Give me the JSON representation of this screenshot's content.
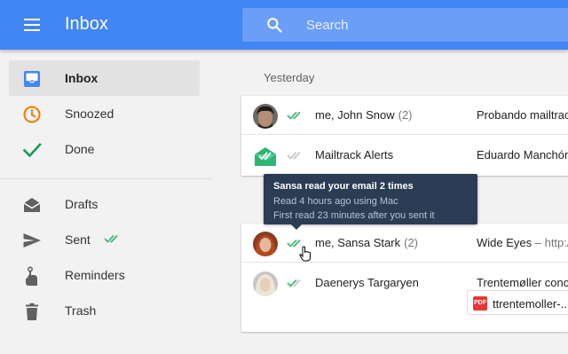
{
  "header": {
    "title": "Inbox",
    "search_placeholder": "Search"
  },
  "colors": {
    "header_blue": "#4285f4",
    "snoozed_orange": "#f57c00",
    "done_green": "#0f9d58",
    "mailtrack_tick_green": "#43b77a",
    "tooltip_navy": "#2b3c55"
  },
  "sidebar": {
    "items": [
      {
        "label": "Inbox",
        "icon": "inbox-icon",
        "active": true
      },
      {
        "label": "Snoozed",
        "icon": "clock-icon"
      },
      {
        "label": "Done",
        "icon": "checkmark-icon"
      },
      {
        "label": "Drafts",
        "icon": "drafts-icon"
      },
      {
        "label": "Sent",
        "icon": "send-icon",
        "badge_icon": "double-check-icon"
      },
      {
        "label": "Reminders",
        "icon": "reminder-icon"
      },
      {
        "label": "Trash",
        "icon": "trash-icon"
      }
    ]
  },
  "main": {
    "section_label": "Yesterday",
    "emails": [
      {
        "sender": "me, John Snow",
        "count": "(2)",
        "subject": "Probando mailtrack",
        "snippet": "",
        "ticks": "read",
        "avatar": "john-snow-avatar"
      },
      {
        "sender": "Mailtrack Alerts",
        "count": "",
        "subject": "Eduardo Manchón",
        "snippet": "",
        "ticks": "unread",
        "avatar": "mailtrack-logo"
      },
      {
        "sender": "me, Sansa Stark",
        "count": "(2)",
        "subject": "Wide Eyes",
        "snippet": " – http://",
        "ticks": "read",
        "avatar": "sansa-stark-avatar"
      },
      {
        "sender": "Daenerys Targaryen",
        "count": "",
        "subject": "Trentemøller conce",
        "snippet": "",
        "ticks": "partial",
        "avatar": "daenerys-avatar",
        "attachment": {
          "type": "PDF",
          "name": "ttrentemoller-..."
        }
      }
    ]
  },
  "tooltip": {
    "title": "Sansa read your email 2 times",
    "line1": "Read 4 hours ago using Mac",
    "line2": "First read 23 minutes after you sent it"
  }
}
